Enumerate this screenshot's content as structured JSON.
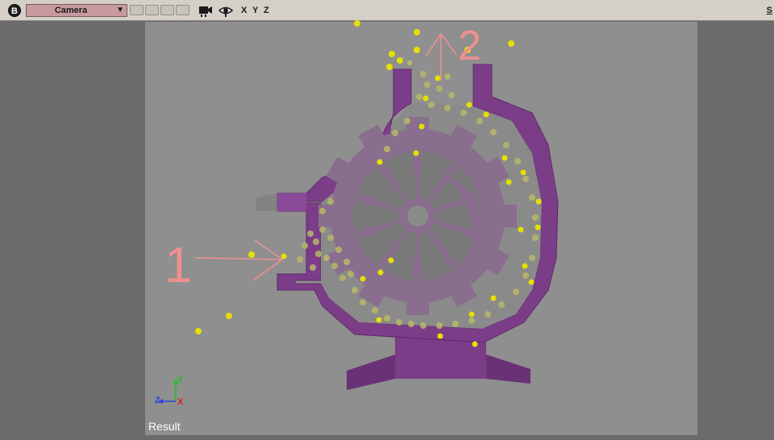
{
  "toolbar": {
    "badge": "B",
    "view_mode": "Camera",
    "axis_x": "X",
    "axis_y": "Y",
    "axis_z": "Z",
    "right_label": "S"
  },
  "viewport": {
    "result_label": "Result",
    "axis_gizmo": {
      "y": "Y",
      "z": "Z",
      "x": "X"
    },
    "annotations": {
      "marker_1": "1",
      "marker_2": "2"
    }
  },
  "colors": {
    "toolbar_bg": "#d4d0c8",
    "viewport_bg": "#8f8f8f",
    "housing": "#7c3d88",
    "gear": "#8a6e8e",
    "particle_bright": "#e6e000",
    "particle_dim": "#b8b868",
    "annotation": "#f09090"
  }
}
